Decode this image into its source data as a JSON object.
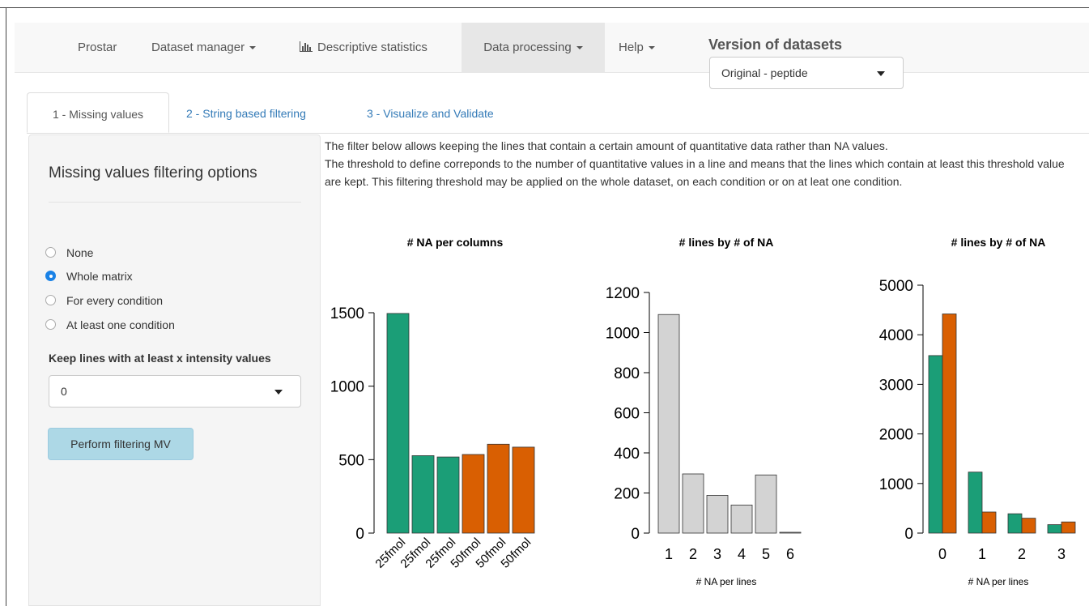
{
  "navbar": {
    "items": [
      {
        "label": "Prostar"
      },
      {
        "label": "Dataset manager"
      },
      {
        "label": "Descriptive statistics",
        "icon": "bar-chart-icon"
      },
      {
        "label": "Data processing",
        "active": true
      },
      {
        "label": "Help"
      }
    ],
    "version_title": "Version of datasets",
    "version_selected": "Original - peptide"
  },
  "tabs": [
    {
      "label": "1 - Missing values",
      "active": true
    },
    {
      "label": "2 - String based filtering"
    },
    {
      "label": "3 - Visualize and Validate"
    }
  ],
  "sidebar": {
    "title": "Missing values filtering options",
    "options": [
      {
        "label": "None",
        "checked": false
      },
      {
        "label": "Whole matrix",
        "checked": true
      },
      {
        "label": "For every condition",
        "checked": false
      },
      {
        "label": "At least one condition",
        "checked": false
      }
    ],
    "keep_label": "Keep lines with at least x intensity values",
    "keep_value": "0",
    "perform_button": "Perform filtering MV"
  },
  "description": {
    "line1": "The filter below allows keeping the lines that contain a certain amount of quantitative data rather than NA values.",
    "line2": "The threshold to define correponds to the number of quantitative values in a line and means that the lines which contain at least this threshold value are kept. This filtering threshold may be applied on the whole dataset, on each condition or on at leat one condition."
  },
  "colors": {
    "green": "#1b9e77",
    "orange": "#d95f02",
    "grey": "#d3d3d3"
  },
  "chart_data": [
    {
      "type": "bar",
      "title": "# NA per columns",
      "categories": [
        "25fmol",
        "25fmol",
        "25fmol",
        "50fmol",
        "50fmol",
        "50fmol"
      ],
      "values": [
        1495,
        527,
        518,
        535,
        605,
        585
      ],
      "bar_colors": [
        "#1b9e77",
        "#1b9e77",
        "#1b9e77",
        "#d95f02",
        "#d95f02",
        "#d95f02"
      ],
      "yticks": [
        0,
        500,
        1000,
        1500
      ],
      "ylim": [
        0,
        1500
      ],
      "xlabel": "",
      "ylabel": ""
    },
    {
      "type": "bar",
      "title": "# lines by # of NA",
      "categories": [
        "1",
        "2",
        "3",
        "4",
        "5",
        "6"
      ],
      "values": [
        1090,
        295,
        188,
        140,
        290,
        3
      ],
      "bar_colors": [
        "#d3d3d3",
        "#d3d3d3",
        "#d3d3d3",
        "#d3d3d3",
        "#d3d3d3",
        "#d3d3d3"
      ],
      "yticks": [
        0,
        200,
        400,
        600,
        800,
        1000,
        1200
      ],
      "ylim": [
        0,
        1200
      ],
      "xlabel": "# NA per lines",
      "ylabel": ""
    },
    {
      "type": "bar",
      "title": "# lines by # of NA",
      "categories": [
        "0",
        "1",
        "2",
        "3"
      ],
      "series": [
        {
          "values": [
            3580,
            1230,
            390,
            170
          ],
          "color": "#1b9e77"
        },
        {
          "values": [
            4420,
            425,
            300,
            225
          ],
          "color": "#d95f02"
        }
      ],
      "yticks": [
        0,
        1000,
        2000,
        3000,
        4000,
        5000
      ],
      "ylim": [
        0,
        5000
      ],
      "xlabel": "# NA per lines",
      "ylabel": ""
    }
  ]
}
